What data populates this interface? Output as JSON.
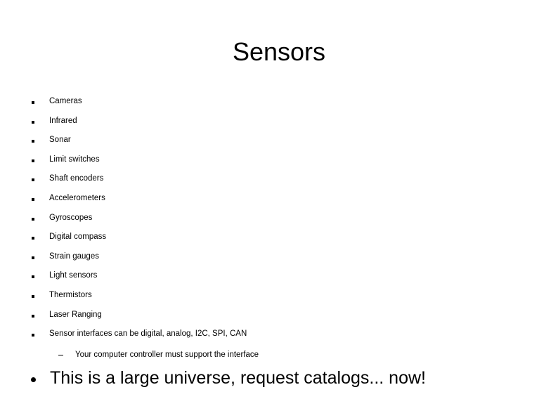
{
  "slide": {
    "title": "Sensors",
    "background_color": "#ffffff",
    "text_color": "#000000",
    "bullets": [
      {
        "marker": "square-bullet",
        "text": "Cameras"
      },
      {
        "marker": "square-bullet",
        "text": "Infrared"
      },
      {
        "marker": "square-bullet",
        "text": "Sonar"
      },
      {
        "marker": "square-bullet",
        "text": "Limit switches"
      },
      {
        "marker": "square-bullet",
        "text": "Shaft encoders"
      },
      {
        "marker": "square-bullet",
        "text": "Accelerometers"
      },
      {
        "marker": "square-bullet",
        "text": "Gyroscopes"
      },
      {
        "marker": "square-bullet",
        "text": "Digital compass"
      },
      {
        "marker": "square-bullet",
        "text": "Strain gauges"
      },
      {
        "marker": "square-bullet",
        "text": "Light sensors"
      },
      {
        "marker": "square-bullet",
        "text": "Thermistors"
      },
      {
        "marker": "square-bullet",
        "text": "Laser Ranging"
      },
      {
        "marker": "square-bullet",
        "text": "Sensor interfaces can be digital, analog, I2C, SPI, CAN"
      }
    ],
    "sub_bullet": {
      "marker": "dash-bullet",
      "text": "Your computer controller must support the interface"
    },
    "final_bullet": {
      "marker": "disc-bullet",
      "text": "This is a large universe, request catalogs... now!"
    }
  }
}
